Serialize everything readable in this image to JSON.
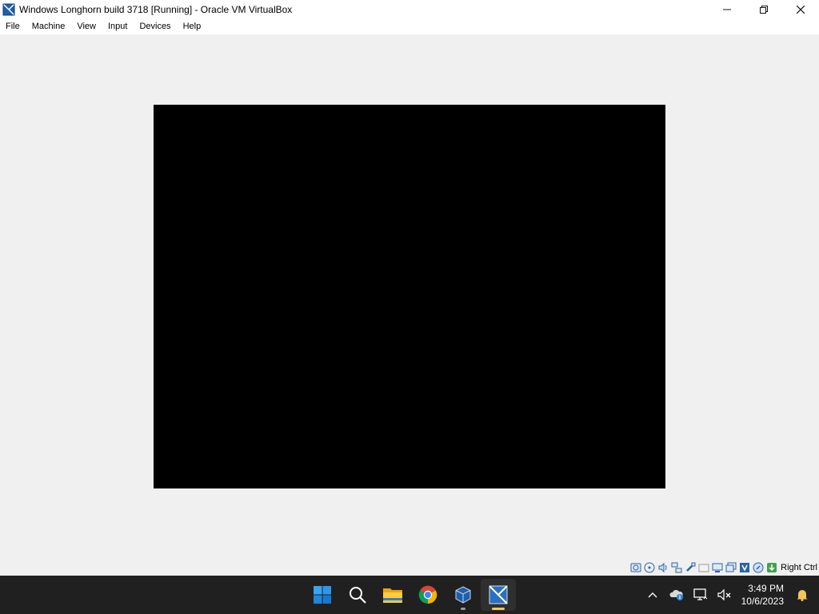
{
  "window": {
    "title": "Windows Longhorn build 3718 [Running] - Oracle VM VirtualBox",
    "controls": {
      "minimize": "—",
      "maximize": "❐",
      "close": "✕"
    }
  },
  "menu": {
    "items": [
      {
        "label": "File"
      },
      {
        "label": "Machine"
      },
      {
        "label": "View"
      },
      {
        "label": "Input"
      },
      {
        "label": "Devices"
      },
      {
        "label": "Help"
      }
    ]
  },
  "statusbar": {
    "icons": [
      "hard-disk-icon",
      "optical-drive-icon",
      "audio-icon",
      "network-icon",
      "usb-icon",
      "shared-folders-icon",
      "display-icon",
      "video-capture-icon",
      "virtualization-icon",
      "mouse-integration-icon",
      "keyboard-icon"
    ],
    "host_key": "Right Ctrl"
  },
  "taskbar": {
    "apps": [
      {
        "name": "start-icon"
      },
      {
        "name": "search-icon"
      },
      {
        "name": "file-explorer-icon"
      },
      {
        "name": "chrome-icon"
      },
      {
        "name": "virtualbox-manager-icon",
        "running": true
      },
      {
        "name": "virtualbox-vm-icon",
        "running": true,
        "active": true
      }
    ],
    "tray": {
      "time": "3:49 PM",
      "date": "10/6/2023"
    }
  },
  "colors": {
    "taskbar_bg": "#202020",
    "window_bg": "#f0f0f0",
    "vm_screen": "#000000",
    "active_indicator": "#f2c55c"
  }
}
